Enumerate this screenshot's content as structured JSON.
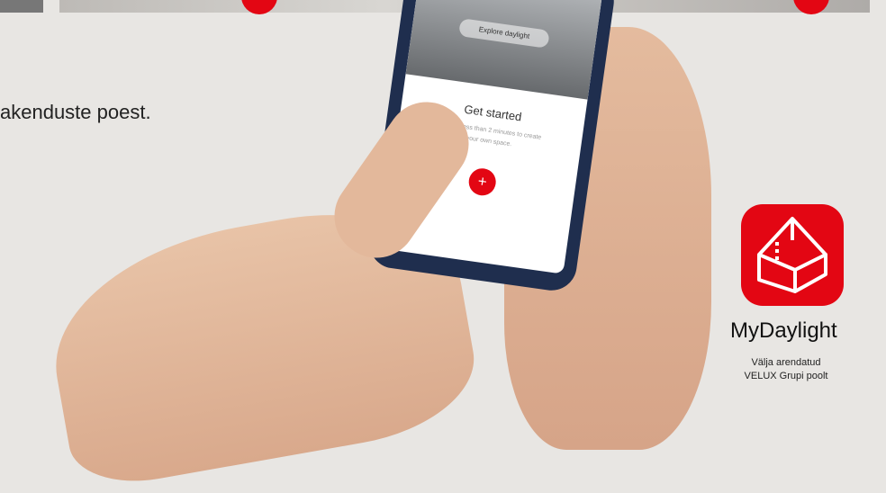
{
  "background_text": "akenduste poest.",
  "phone": {
    "explore_label": "Explore daylight",
    "title": "Get started",
    "subtitle": "It takes less than 2 minutes to create your own space.",
    "add_symbol": "+"
  },
  "app": {
    "name": "MyDaylight",
    "credit_line_1": "Välja arendatud",
    "credit_line_2": "VELUX Grupi poolt",
    "icon": "mydaylight-house-icon",
    "brand_color": "#e30613"
  }
}
